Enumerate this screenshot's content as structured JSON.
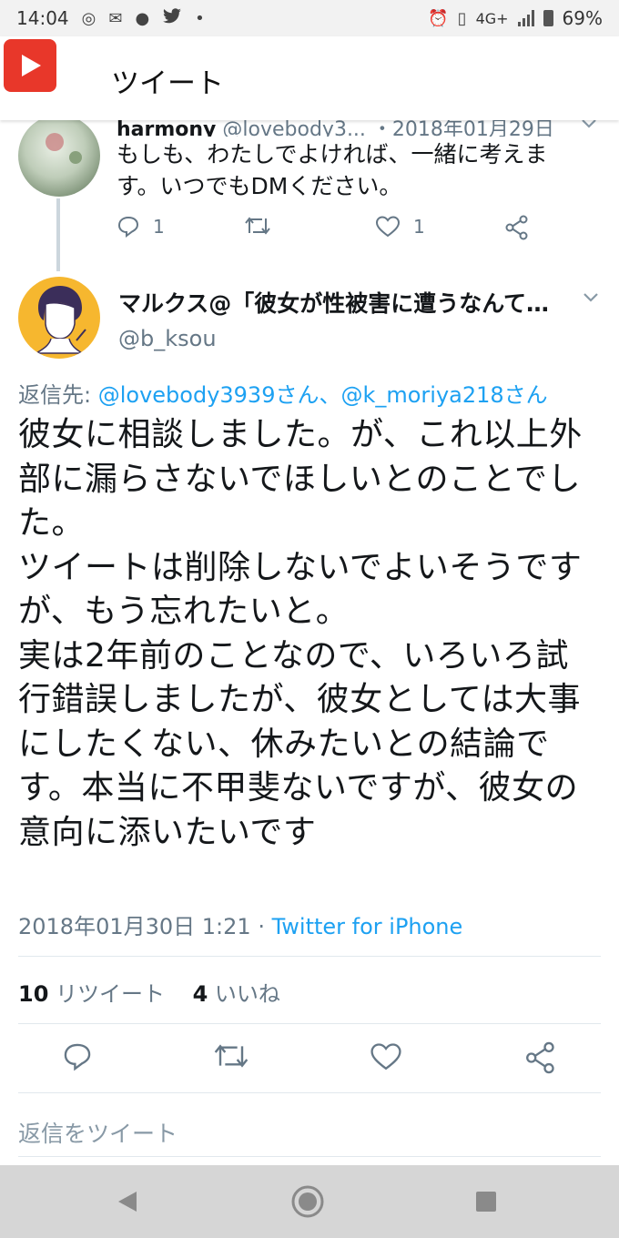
{
  "status_bar": {
    "time": "14:04",
    "network": "4G+",
    "battery": "69%"
  },
  "header": {
    "title": "ツイート"
  },
  "previous_tweet": {
    "name": "harmony",
    "handle": "@lovebody3...",
    "date": "・2018年01月29日",
    "text": "もしも、わたしでよければ、一緒に考えます。いつでもDMください。",
    "reply_count": "1",
    "like_count": "1"
  },
  "tweet": {
    "name": "マルクス@「彼女が性被害に遭うなんて…",
    "handle": "@b_ksou",
    "reply_prefix": "返信先: ",
    "reply_to": "@lovebody3939さん、@k_moriya218さん",
    "text": "彼女に相談しました。が、これ以上外部に漏らさないでほしいとのことでした。\nツイートは削除しないでよいそうです\nが、もう忘れたいと。\n実は2年前のことなので、いろいろ試行錯誤しましたが、彼女としては大事にしたくない、休みたいとの結論です。本当に不甲斐ないですが、彼女の意向に添いたいです",
    "timestamp": "2018年01月30日 1:21",
    "separator": " · ",
    "client": "Twitter for iPhone",
    "retweet_count": "10",
    "retweet_label": " リツイート",
    "like_count": "4",
    "like_label": " いいね"
  },
  "reply_box": {
    "placeholder": "返信をツイート"
  },
  "colors": {
    "link": "#1da1f2",
    "muted": "#657786",
    "avatar_yellow": "#f6b72f",
    "youtube_red": "#e8372a"
  }
}
